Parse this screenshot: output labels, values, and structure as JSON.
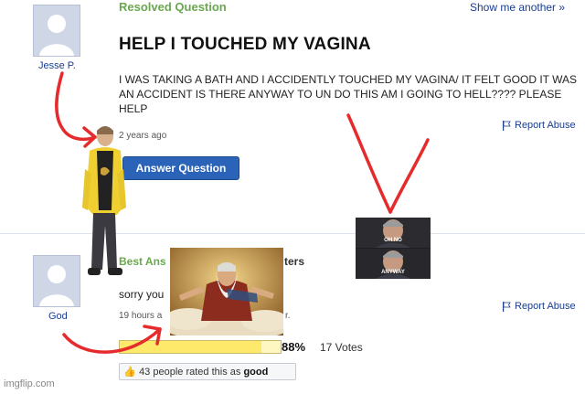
{
  "question": {
    "status": "Resolved Question",
    "show_more": "Show me another »",
    "title": "HELP I TOUCHED MY VAGINA",
    "body": "I WAS TAKING A BATH AND I ACCIDENTLY TOUCHED MY VAGINA/ IT FELT GOOD IT WAS AN ACCIDENT IS THERE ANYWAY TO UN DO THIS AM I GOING TO HELL???? PLEASE HELP",
    "asker": "Jesse P.",
    "time": "2 years ago",
    "report": "Report Abuse",
    "answer_button": "Answer Question"
  },
  "best_answer": {
    "label_prefix": "Best Ans",
    "label_suffix": "ters",
    "answerer": "God",
    "text": "sorry you",
    "time": "19 hours a",
    "time_suffix": "r.",
    "report": "Report Abuse",
    "rating_percent": "88%",
    "rating_fraction": 0.88,
    "votes": "17 Votes",
    "rated_prefix": "43 people rated this as",
    "rated_word": "good"
  },
  "meme_captions": {
    "top": "OH NO",
    "bottom": "ANYWAY"
  },
  "watermark": "imgflip.com",
  "colors": {
    "link": "#1a3d8f",
    "resolved": "#6aa84f",
    "arrow": "#e52b2b",
    "button": "#2a63b8"
  }
}
